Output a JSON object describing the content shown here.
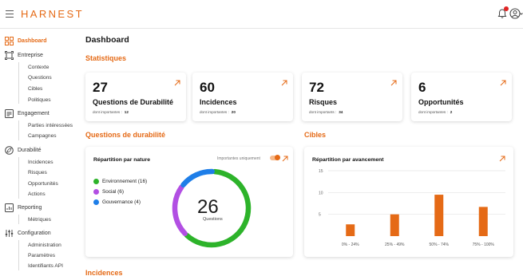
{
  "app": {
    "logo": "HARNEST"
  },
  "sidebar": {
    "groups": [
      {
        "label": "Dashboard",
        "icon": "grid-icon",
        "active": true,
        "items": []
      },
      {
        "label": "Entreprise",
        "icon": "building-icon",
        "active": false,
        "items": [
          "Contexte",
          "Questions",
          "Cibles",
          "Politiques"
        ]
      },
      {
        "label": "Engagement",
        "icon": "handshake-icon",
        "active": false,
        "items": [
          "Parties intéressées",
          "Campagnes"
        ]
      },
      {
        "label": "Durabilité",
        "icon": "leaf-icon",
        "active": false,
        "items": [
          "Incidences",
          "Risques",
          "Opportunités",
          "Actions"
        ]
      },
      {
        "label": "Reporting",
        "icon": "report-icon",
        "active": false,
        "items": [
          "Métriques"
        ]
      },
      {
        "label": "Configuration",
        "icon": "sliders-icon",
        "active": false,
        "items": [
          "Administration",
          "Paramètres",
          "Identifiants API"
        ]
      }
    ]
  },
  "main": {
    "title": "Dashboard",
    "sections": {
      "statistiques": "Statistiques",
      "questions": "Questions de durabilité",
      "cibles": "Cibles",
      "incidences": "Incidences"
    },
    "stats": [
      {
        "value": "27",
        "label": "Questions de Durabilité",
        "sub_label": "dont importantes :",
        "sub_value": "12"
      },
      {
        "value": "60",
        "label": "Incidences",
        "sub_label": "dont importantes :",
        "sub_value": "20"
      },
      {
        "value": "72",
        "label": "Risques",
        "sub_label": "dont importants :",
        "sub_value": "34"
      },
      {
        "value": "6",
        "label": "Opportunités",
        "sub_label": "dont importantes :",
        "sub_value": "2"
      }
    ],
    "nature_panel": {
      "title": "Répartition par nature",
      "toggle_label": "Importantes uniquement",
      "toggle_on": true,
      "total": "26",
      "total_label": "Questions"
    },
    "avancement_panel": {
      "title": "Répartition par avancement"
    }
  },
  "colors": {
    "accent": "#e56a16",
    "env": "#2db32a",
    "social": "#b24fe3",
    "gouv": "#1e7ee8"
  },
  "chart_data": [
    {
      "type": "pie",
      "title": "Répartition par nature",
      "categories": [
        "Environnement (16)",
        "Social (6)",
        "Gouvernance (4)"
      ],
      "values": [
        16,
        6,
        4
      ],
      "colors": [
        "#2db32a",
        "#b24fe3",
        "#1e7ee8"
      ]
    },
    {
      "type": "bar",
      "title": "Répartition par avancement",
      "categories": [
        "0% - 24%",
        "25% - 49%",
        "50% - 74%",
        "75% - 100%"
      ],
      "values": [
        2.7,
        5,
        9.5,
        6.7
      ],
      "ylim": [
        0,
        15
      ],
      "yticks": [
        5,
        10,
        15
      ],
      "grid": true,
      "color": "#e56a16"
    }
  ]
}
